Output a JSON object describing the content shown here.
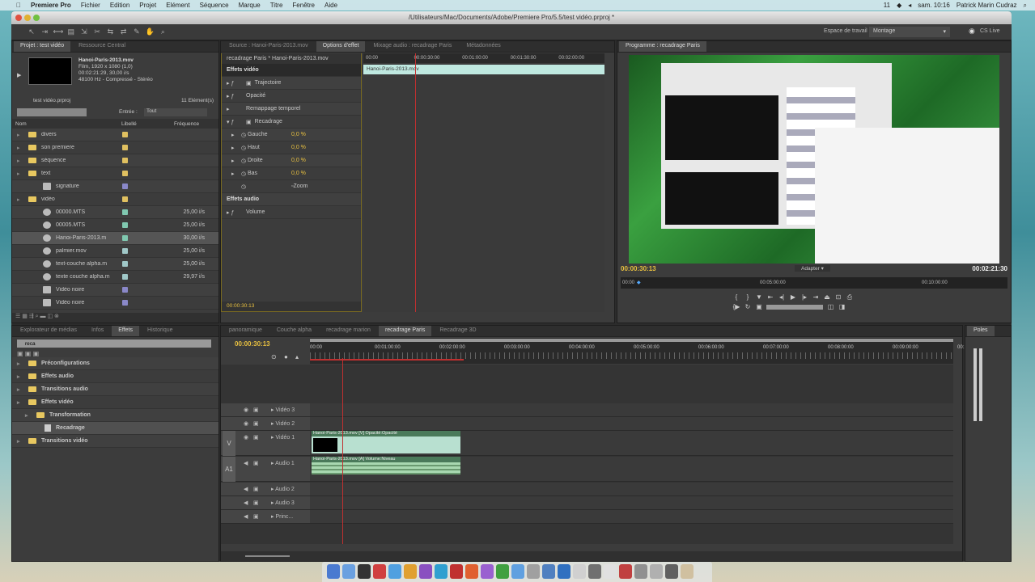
{
  "menubar": {
    "app": "Premiere Pro",
    "items": [
      "Fichier",
      "Edition",
      "Projet",
      "Elément",
      "Séquence",
      "Marque",
      "Titre",
      "Fenêtre",
      "Aide"
    ],
    "status": "11",
    "clock": "sam. 10:16",
    "user": "Patrick Marin Cudraz"
  },
  "window": {
    "title": "/Utilisateurs/Mac/Documents/Adobe/Premiere Pro/5.5/test vidéo.prproj *"
  },
  "toolbar": {
    "workspace_label": "Espace de travail :",
    "workspace_value": "Montage",
    "cs_live": "CS Live"
  },
  "project": {
    "tabs": [
      "Projet : test vidéo",
      "Ressource Central"
    ],
    "clip_name": "Hanoi-Paris-2013.mov",
    "clip_info": [
      "Film, 1920 x 1080 (1,0)",
      "00:02:21:29, 30,00 i/s",
      "48100 Hz - Compressé - Stéréo"
    ],
    "project_file": "test vidéo.prproj",
    "item_count": "11 Elément(s)",
    "search_placeholder": "",
    "entry_label": "Entrée :",
    "entry_value": "Tout",
    "columns": [
      "Nom",
      "Libellé",
      "Fréquence"
    ],
    "items": [
      {
        "name": "divers",
        "type": "folder",
        "color": "#e0c060",
        "rate": ""
      },
      {
        "name": "son premiere",
        "type": "folder",
        "color": "#e0c060",
        "rate": ""
      },
      {
        "name": "séquence",
        "type": "folder",
        "color": "#e0c060",
        "rate": ""
      },
      {
        "name": "text",
        "type": "folder",
        "color": "#e0c060",
        "rate": ""
      },
      {
        "name": "signature",
        "type": "file",
        "color": "#8a88c8",
        "rate": ""
      },
      {
        "name": "vidéo",
        "type": "folder",
        "color": "#e0c060",
        "rate": ""
      },
      {
        "name": "00000.MTS",
        "type": "clip",
        "color": "#80c8b0",
        "rate": "25,00 i/s"
      },
      {
        "name": "00005.MTS",
        "type": "clip",
        "color": "#80c8b0",
        "rate": "25,00 i/s"
      },
      {
        "name": "Hanoi-Paris-2013.m",
        "type": "clip",
        "color": "#80c8b0",
        "rate": "30,00 i/s"
      },
      {
        "name": "palmier.mov",
        "type": "clip",
        "color": "#a0c8c8",
        "rate": "25,00 i/s"
      },
      {
        "name": "text-couche alpha.m",
        "type": "clip",
        "color": "#a0c8c8",
        "rate": "25,00 i/s"
      },
      {
        "name": "texte couche alpha.m",
        "type": "clip",
        "color": "#a0c8c8",
        "rate": "29,97 i/s"
      },
      {
        "name": "Vidéo noire",
        "type": "file",
        "color": "#8a88c8",
        "rate": ""
      },
      {
        "name": "Vidéo noire",
        "type": "file",
        "color": "#8a88c8",
        "rate": ""
      }
    ]
  },
  "effect_controls": {
    "tabs": [
      "Source : Hanoi-Paris-2013.mov",
      "Options d'effet",
      "Mixage audio : recadrage Paris",
      "Métadonnées"
    ],
    "header": "recadrage Paris * Hanoi-Paris-2013.mov",
    "ruler": [
      "00:00",
      "00:00:30:00",
      "00:01:00:00",
      "00:01:30:00",
      "00:02:00:00"
    ],
    "clip": "Hanoi-Paris-2013.mov",
    "video_effects": "Effets vidéo",
    "rows": [
      {
        "label": "Trajectoire"
      },
      {
        "label": "Opacité"
      },
      {
        "label": "Remappage temporel"
      },
      {
        "label": "Recadrage"
      }
    ],
    "params": [
      {
        "label": "Gauche",
        "value": "0,0 %"
      },
      {
        "label": "Haut",
        "value": "0,0 %"
      },
      {
        "label": "Droite",
        "value": "0,0 %"
      },
      {
        "label": "Bas",
        "value": "0,0 %"
      }
    ],
    "zoom": "Zoom",
    "audio_effects": "Effets audio",
    "volume": "Volume",
    "timecode": "00:00:30:13"
  },
  "program": {
    "tab": "Programme : recadrage Paris",
    "timecode": "00:00:30:13",
    "fit": "Adapter",
    "duration": "00:02:21:30",
    "ruler": [
      "00:00",
      "00:05:00:00",
      "00:10:00:00"
    ]
  },
  "effects": {
    "tabs": [
      "Explorateur de médias",
      "Infos",
      "Effets",
      "Historique"
    ],
    "search_value": "reca",
    "tree": [
      {
        "label": "Préconfigurations",
        "indent": 0
      },
      {
        "label": "Effets audio",
        "indent": 0
      },
      {
        "label": "Transitions audio",
        "indent": 0
      },
      {
        "label": "Effets vidéo",
        "indent": 0
      },
      {
        "label": "Transformation",
        "indent": 1
      },
      {
        "label": "Recadrage",
        "indent": 2
      },
      {
        "label": "Transitions vidéo",
        "indent": 0
      }
    ]
  },
  "timeline": {
    "tabs": [
      "panoramique",
      "Couche alpha",
      "recadrage marion",
      "recadrage Paris",
      "Recadrage 3D"
    ],
    "active_tab": 3,
    "timecode": "00:00:30:13",
    "ruler": [
      "00:00",
      "00:01:00:00",
      "00:02:00:00",
      "00:03:00:00",
      "00:04:00:00",
      "00:05:00:00",
      "00:06:00:00",
      "00:07:00:00",
      "00:08:00:00",
      "00:09:00:00",
      "00:1"
    ],
    "tracks": [
      "Vidéo 3",
      "Vidéo 2",
      "Vidéo 1",
      "Audio 1",
      "Audio 2",
      "Audio 3",
      "Princ..."
    ],
    "side_labels": [
      "V",
      "A1"
    ],
    "video_clip": "Hanoi-Paris-2013.mov [V] Opacité:Opacité",
    "audio_clip": "Hanoi-Paris-2013.mov [A] Volume:Niveau"
  },
  "meters": {
    "tab": "Poles"
  },
  "playhead_fraction": 0.21
}
